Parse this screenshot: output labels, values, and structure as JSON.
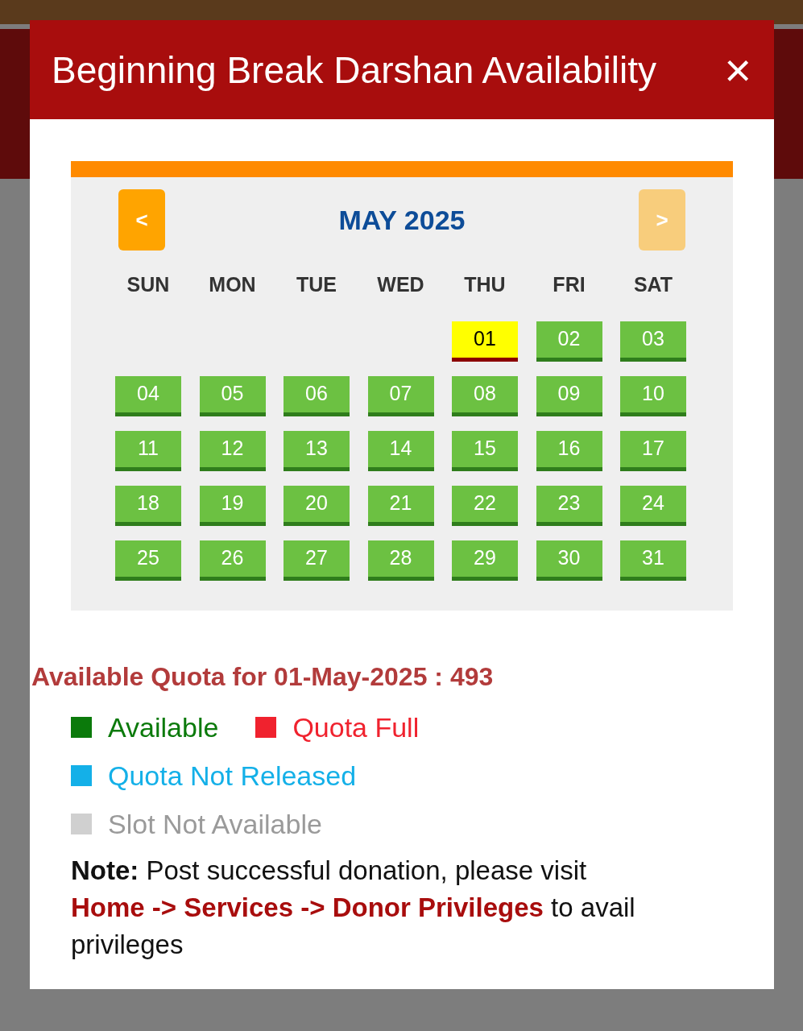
{
  "dialog": {
    "title": "Beginning Break Darshan Availability",
    "close": "×"
  },
  "calendar": {
    "prev": "<",
    "next": ">",
    "prev_disabled": false,
    "next_disabled": true,
    "month": "MAY 2025",
    "weekdays": [
      "SUN",
      "MON",
      "TUE",
      "WED",
      "THU",
      "FRI",
      "SAT"
    ],
    "weeks": [
      [
        {
          "kind": "empty"
        },
        {
          "kind": "empty"
        },
        {
          "kind": "empty"
        },
        {
          "kind": "empty"
        },
        {
          "kind": "available",
          "day": "01",
          "selected": true
        },
        {
          "kind": "available",
          "day": "02",
          "selected": false
        },
        {
          "kind": "available",
          "day": "03",
          "selected": false
        }
      ],
      [
        {
          "kind": "available",
          "day": "04",
          "selected": false
        },
        {
          "kind": "available",
          "day": "05",
          "selected": false
        },
        {
          "kind": "available",
          "day": "06",
          "selected": false
        },
        {
          "kind": "available",
          "day": "07",
          "selected": false
        },
        {
          "kind": "available",
          "day": "08",
          "selected": false
        },
        {
          "kind": "available",
          "day": "09",
          "selected": false
        },
        {
          "kind": "available",
          "day": "10",
          "selected": false
        }
      ],
      [
        {
          "kind": "available",
          "day": "11",
          "selected": false
        },
        {
          "kind": "available",
          "day": "12",
          "selected": false
        },
        {
          "kind": "available",
          "day": "13",
          "selected": false
        },
        {
          "kind": "available",
          "day": "14",
          "selected": false
        },
        {
          "kind": "available",
          "day": "15",
          "selected": false
        },
        {
          "kind": "available",
          "day": "16",
          "selected": false
        },
        {
          "kind": "available",
          "day": "17",
          "selected": false
        }
      ],
      [
        {
          "kind": "available",
          "day": "18",
          "selected": false
        },
        {
          "kind": "available",
          "day": "19",
          "selected": false
        },
        {
          "kind": "available",
          "day": "20",
          "selected": false
        },
        {
          "kind": "available",
          "day": "21",
          "selected": false
        },
        {
          "kind": "available",
          "day": "22",
          "selected": false
        },
        {
          "kind": "available",
          "day": "23",
          "selected": false
        },
        {
          "kind": "available",
          "day": "24",
          "selected": false
        }
      ],
      [
        {
          "kind": "available",
          "day": "25",
          "selected": false
        },
        {
          "kind": "available",
          "day": "26",
          "selected": false
        },
        {
          "kind": "available",
          "day": "27",
          "selected": false
        },
        {
          "kind": "available",
          "day": "28",
          "selected": false
        },
        {
          "kind": "available",
          "day": "29",
          "selected": false
        },
        {
          "kind": "available",
          "day": "30",
          "selected": false
        },
        {
          "kind": "available",
          "day": "31",
          "selected": false
        }
      ]
    ]
  },
  "quota": "Available Quota for 01-May-2025 : 493",
  "legend": [
    {
      "label": "Available",
      "color": "#0b7a0b"
    },
    {
      "label": "Quota Full",
      "color": "#f0222e"
    },
    {
      "label": "Quota Not Released",
      "color": "#14b0e8"
    },
    {
      "label": "Slot Not Available",
      "color": "#d0d0d0"
    }
  ],
  "note": {
    "label": "Note:",
    "text_before": "Post successful donation, please visit",
    "link": "Home -> Services -> Donor Privileges",
    "text_after": "to avail privileges"
  }
}
